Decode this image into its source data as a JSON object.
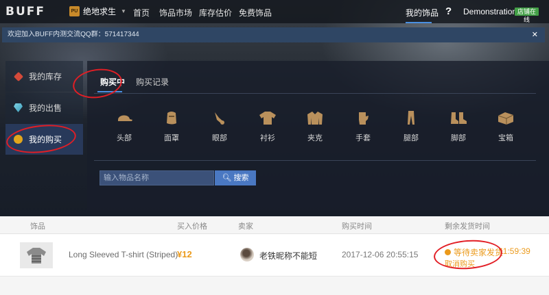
{
  "brand": {
    "logo": "BUFF"
  },
  "game": {
    "name": "绝地求生"
  },
  "nav": {
    "home": "首页",
    "market": "饰品市场",
    "valuation": "库存估价",
    "free": "免费饰品"
  },
  "user": {
    "my_items": "我的饰品",
    "help": "?",
    "name": "Demonstration",
    "store_badge": "店铺在线"
  },
  "notice": {
    "text": "欢迎加入BUFF内测交流QQ群：571417344",
    "close": "✕"
  },
  "sidebar": {
    "items": [
      {
        "label": "我的库存",
        "icon": "heart-gem-icon",
        "active": false
      },
      {
        "label": "我的出售",
        "icon": "diamond-icon",
        "active": false
      },
      {
        "label": "我的购买",
        "icon": "gold-coin-icon",
        "active": true
      }
    ]
  },
  "tabs": {
    "buying": "购买中",
    "history": "购买记录"
  },
  "categories": [
    {
      "label": "头部",
      "icon": "cap-icon"
    },
    {
      "label": "面罩",
      "icon": "mask-icon"
    },
    {
      "label": "眼部",
      "icon": "glasses-icon"
    },
    {
      "label": "衬衫",
      "icon": "shirt-icon"
    },
    {
      "label": "夹克",
      "icon": "jacket-icon"
    },
    {
      "label": "手套",
      "icon": "glove-icon"
    },
    {
      "label": "腿部",
      "icon": "pants-icon"
    },
    {
      "label": "脚部",
      "icon": "boots-icon"
    },
    {
      "label": "宝箱",
      "icon": "crate-icon"
    }
  ],
  "search": {
    "placeholder": "输入物品名称",
    "button": "搜索"
  },
  "table": {
    "headers": {
      "item": "饰品",
      "price": "买入价格",
      "seller": "卖家",
      "time": "购买时间",
      "remaining": "剩余发货时间"
    },
    "rows": [
      {
        "name": "Long Sleeved T-shirt (Striped)",
        "price": "¥12",
        "seller": "老铁昵称不能短",
        "time": "2017-12-06 20:55:15",
        "status": "等待卖家发货",
        "remaining": "11:59:39",
        "action": "取消购买"
      }
    ]
  },
  "colors": {
    "accent": "#4a90e2",
    "price": "#eb9a1b",
    "annotation": "#e21e25",
    "badge": "#43a047"
  }
}
